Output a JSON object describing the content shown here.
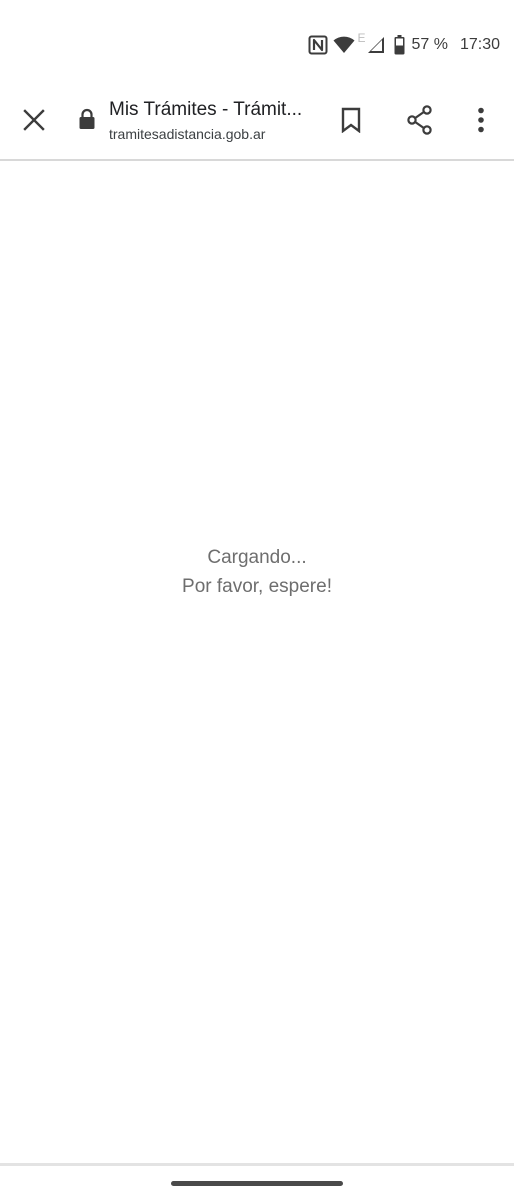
{
  "status_bar": {
    "icons": [
      "nfc-icon",
      "wifi-icon",
      "network-e-icon",
      "signal-icon",
      "battery-icon"
    ],
    "network_type": "E",
    "battery_percent": "57 %",
    "time": "17:30"
  },
  "toolbar": {
    "close_icon": "close-icon",
    "secure_icon": "lock-icon",
    "title": "Mis Trámites - Trámit...",
    "url": "tramitesadistancia.gob.ar",
    "bookmark_icon": "bookmark-icon",
    "share_icon": "share-icon",
    "menu_icon": "more-vert-icon"
  },
  "content": {
    "loading_line1": "Cargando...",
    "loading_line2": "Por favor, espere!"
  },
  "colors": {
    "icon": "#3c3c3c",
    "loading_text": "#6e6e6e",
    "divider": "#d8d8d8"
  }
}
